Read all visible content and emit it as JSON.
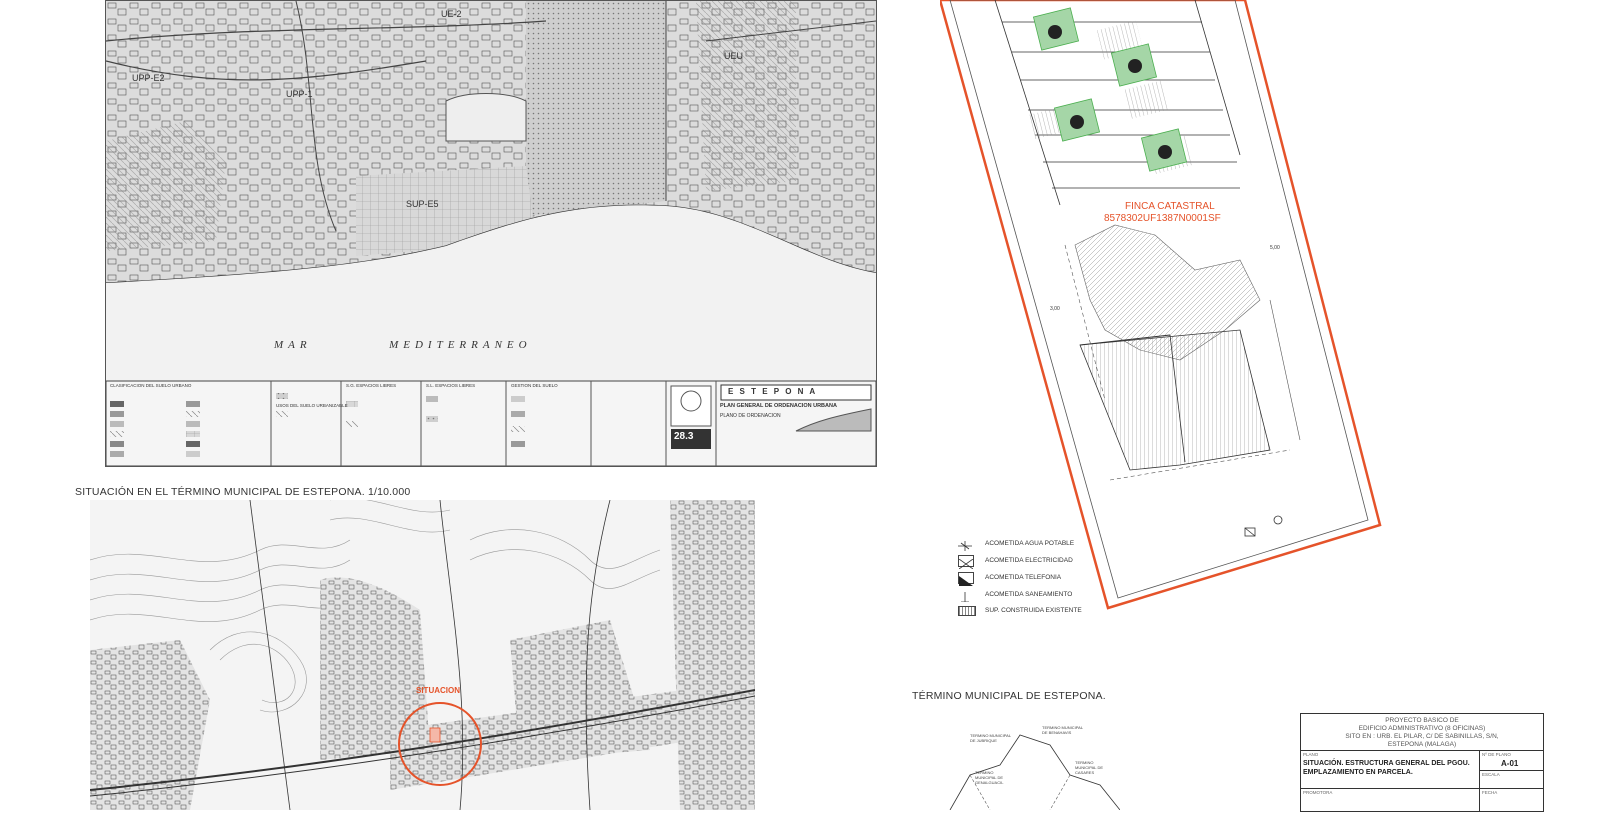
{
  "colors": {
    "accent_red": "#e5532a",
    "green": "#4caf50",
    "line": "#333333"
  },
  "pgou": {
    "zone_labels": [
      "UPP-E2",
      "UPP-1",
      "UE-2",
      "UEU",
      "SUP-E5"
    ],
    "sea_label": "MAR          MEDITERRANEO",
    "legend_title_1": "CLASIFICACION DEL SUELO URBANO",
    "legend_title_2": "S.G. ESPACIOS LIBRES",
    "legend_title_3": "S.L. ESPACIOS LIBRES",
    "legend_title_4": "GESTION DEL SUELO",
    "legend_title_5": "USOS DEL SUELO URBANIZABLE",
    "plan_title": "PLAN GENERAL DE ORDENACION URBANA",
    "town_banner": "E S T E P O N A",
    "sheet_number": "28.3",
    "sheet_subtitle": "PLANO DE ORDENACION"
  },
  "captions": {
    "situacion": "SITUACIÓN EN EL TÉRMINO MUNICIPAL DE ESTEPONA. 1/10.000",
    "termino": "TÉRMINO MUNICIPAL DE ESTEPONA."
  },
  "topo": {
    "marker_label": "SITUACION"
  },
  "site": {
    "finca_label": "FINCA CATASTRAL",
    "finca_ref": "8578302UF1387N0001SF",
    "dim_1": "5,00",
    "dim_2": "3,00"
  },
  "legend": [
    "ACOMETIDA AGUA POTABLE",
    "ACOMETIDA ELECTRICIDAD",
    "ACOMETIDA TELEFONIA",
    "ACOMETIDA SANEAMIENTO",
    "SUP. CONSTRUIDA EXISTENTE"
  ],
  "title_block": {
    "project_line_1": "PROYECTO BASICO DE",
    "project_line_2": "EDIFICIO ADMINISTRATIVO (8 OFICINAS)",
    "project_line_3": "SITO EN : URB. EL PILAR, C/ DE SABINILLAS, S/N,",
    "project_line_4": "ESTEPONA (MALAGA)",
    "plano_label": "PLANO",
    "plano_title_1": "SITUACIÓN. ESTRUCTURA GENERAL DEL PGOU.",
    "plano_title_2": "EMPLAZAMIENTO EN PARCELA.",
    "num_label": "Nº DE PLANO",
    "num_value": "A-01",
    "escala_label": "ESCALA",
    "promotor_label": "PROMOTORA",
    "fecha_label": "FECHA"
  },
  "termino_map": {
    "labels": [
      "TERMINO MUNICIPAL DE BENAHAVIS",
      "TERMINO MUNICIPAL DE JUBRIQUE",
      "TERMINO MUNICIPAL DE GENALGUACIL",
      "TERMINO MUNICIPAL DE CASARES"
    ]
  }
}
